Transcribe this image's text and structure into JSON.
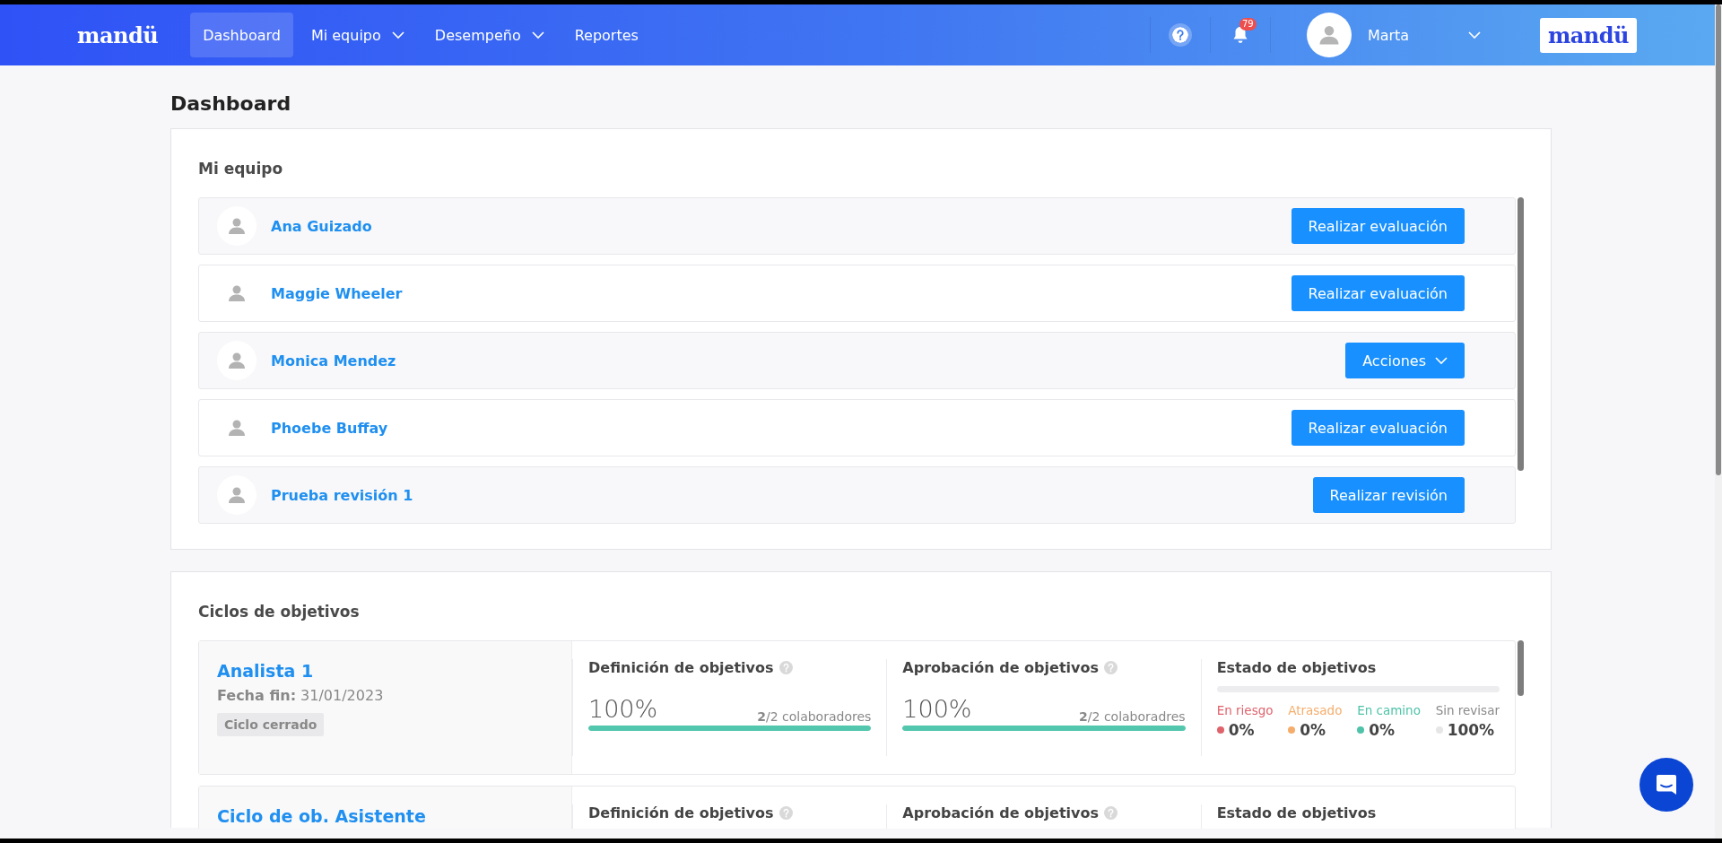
{
  "nav": {
    "logo": "mandü",
    "items": [
      {
        "label": "Dashboard",
        "selected": true,
        "dropdown": false
      },
      {
        "label": "Mi equipo",
        "selected": false,
        "dropdown": true
      },
      {
        "label": "Desempeño",
        "selected": false,
        "dropdown": true
      },
      {
        "label": "Reportes",
        "selected": false,
        "dropdown": false
      }
    ],
    "notifications": "79",
    "user": "Marta",
    "brand_logo": "mandü"
  },
  "page_title": "Dashboard",
  "team": {
    "title": "Mi equipo",
    "members": [
      {
        "name": "Ana Guizado",
        "action": {
          "label": "Realizar evaluación",
          "kind": "button"
        }
      },
      {
        "name": "Maggie Wheeler",
        "action": {
          "label": "Realizar evaluación",
          "kind": "button"
        }
      },
      {
        "name": "Monica Mendez",
        "action": {
          "label": "Acciones",
          "kind": "dropdown"
        }
      },
      {
        "name": "Phoebe Buffay",
        "action": {
          "label": "Realizar evaluación",
          "kind": "button"
        }
      },
      {
        "name": "Prueba revisión 1",
        "action": {
          "label": "Realizar revisión",
          "kind": "button"
        }
      }
    ]
  },
  "cycles": {
    "title": "Ciclos de objetivos",
    "items": [
      {
        "name": "Analista 1",
        "end_label": "Fecha fin:",
        "end_date": "31/01/2023",
        "tag": "Ciclo cerrado",
        "definition": {
          "title": "Definición de objetivos",
          "percent": "100%",
          "level": 1,
          "count": "**2**/2 colaboradores"
        },
        "approval": {
          "title": "Aprobación de objetivos",
          "percent": "100%",
          "level": 1,
          "count": "**2**/2 colaboradres"
        },
        "status": {
          "title": "Estado de objetivos",
          "categories": [
            {
              "label": "En riesgo",
              "value": "0%",
              "color": "#e0636b"
            },
            {
              "label": "Atrasado",
              "value": "0%",
              "color": "#f5ad6b"
            },
            {
              "label": "En camino",
              "value": "0%",
              "color": "#4fc3a9"
            },
            {
              "label": "Sin revisar",
              "value": "100%",
              "color": "#e6e6e6"
            }
          ]
        }
      },
      {
        "name": "Ciclo de ob. Asistente",
        "definition": {
          "title": "Definición de objetivos"
        },
        "approval": {
          "title": "Aprobación de objetivos"
        },
        "status": {
          "title": "Estado de objetivos"
        }
      }
    ]
  }
}
